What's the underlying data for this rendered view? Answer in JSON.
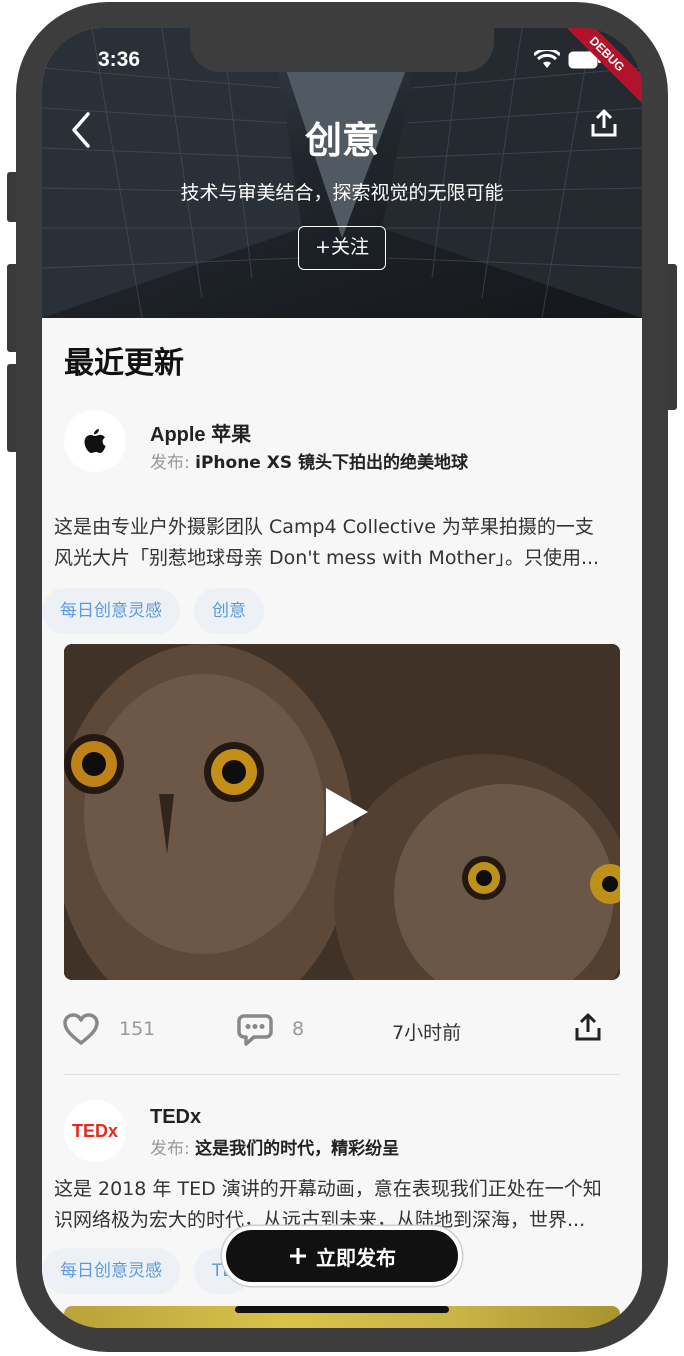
{
  "status_bar": {
    "time": "3:36",
    "debug_label": "DEBUG"
  },
  "header": {
    "title": "创意",
    "subtitle": "技术与审美结合，探索视觉的无限可能",
    "follow_label": "+关注",
    "icons": {
      "back": "chevron-left-icon",
      "share": "share-icon"
    }
  },
  "section": {
    "title": "最近更新"
  },
  "posts": [
    {
      "author": "Apple 苹果",
      "publish_label": "发布:",
      "publish_title": "iPhone XS 镜头下拍出的绝美地球",
      "description_lines": [
        "这是由专业户外摄影团队 Camp4 Collective 为苹果拍摄的一支",
        "风光大片「别惹地球母亲 Don't mess with Mother」。只使用..."
      ],
      "tags": [
        "每日创意灵感",
        "创意"
      ],
      "likes": "151",
      "comments": "8",
      "time": "7小时前"
    },
    {
      "author": "TEDx",
      "avatar_text": "TEDx",
      "publish_label": "发布:",
      "publish_title": "这是我们的时代，精彩纷呈",
      "description_lines": [
        "这是 2018 年 TED 演讲的开幕动画，意在表现我们正处在一个知",
        "识网络极为宏大的时代，从远古到未来，从陆地到深海，世界..."
      ],
      "tags": [
        "每日创意灵感",
        "TE"
      ]
    }
  ],
  "publish_button": {
    "label": "立即发布",
    "icon": "plus-icon"
  },
  "colors": {
    "tag_text": "#5d9ad8",
    "tag_bg": "#edf1f6",
    "ted_red": "#e62b1e"
  }
}
